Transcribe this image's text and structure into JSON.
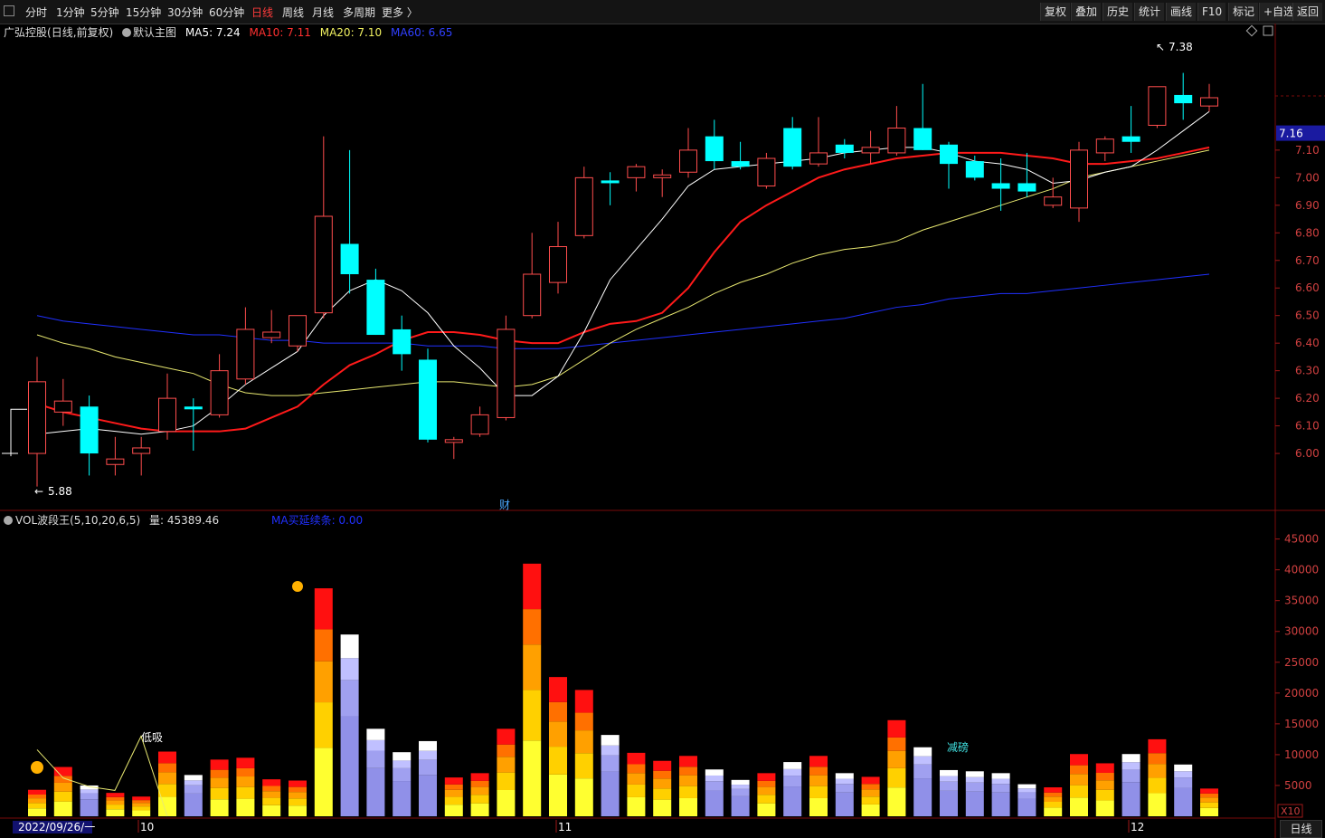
{
  "toolbar": {
    "periods": [
      "分时",
      "1分钟",
      "5分钟",
      "15分钟",
      "30分钟",
      "60分钟",
      "日线",
      "周线",
      "月线",
      "多周期",
      "更多 〉"
    ],
    "active_period": "日线",
    "right_buttons": [
      "复权",
      "叠加",
      "历史",
      "统计",
      "画线",
      "F10",
      "标记",
      "+自选",
      "返回"
    ]
  },
  "main_header": {
    "stock": "广弘控股",
    "mode": "(日线,前复权)",
    "template_label": "默认主图",
    "ma5_label": "MA5: 7.24",
    "ma10_label": "MA10: 7.11",
    "ma20_label": "MA20: 7.10",
    "ma60_label": "MA60: 6.65"
  },
  "vol_header": {
    "indicator": "VOL波段王(5,10,20,6,5)",
    "volume_label": "量: 45389.46",
    "ma_label": "MA买延续条: 0.00"
  },
  "annotations": {
    "high_price": "7.38",
    "low_price": "5.88",
    "finance_marker": "财",
    "low_buy": "低吸",
    "reduce": "减磅",
    "current_price": "7.16",
    "vol_scale_unit": "X10"
  },
  "bottom": {
    "start_date": "2022/09/26/一",
    "month_labels": [
      "10",
      "11",
      "12"
    ],
    "period_tab": "日线"
  },
  "colors": {
    "up": "#ff4d4d",
    "down": "#00ffff",
    "ma5": "#ffffff",
    "ma10": "#ff1a1a",
    "ma20": "#e8e870",
    "ma60": "#2030ff"
  },
  "chart_data": {
    "type": "candlestick",
    "price_axis": {
      "min": 5.8,
      "max": 7.5,
      "ticks": [
        "7.10",
        "7.00",
        "6.90",
        "6.80",
        "6.70",
        "6.60",
        "6.50",
        "6.40",
        "6.30",
        "6.20",
        "6.10",
        "6.00"
      ]
    },
    "volume_axis": {
      "min": 0,
      "max": 47000,
      "ticks": [
        "45000",
        "40000",
        "35000",
        "30000",
        "25000",
        "20000",
        "15000",
        "10000",
        "5000"
      ]
    },
    "candles": [
      {
        "o": 6.0,
        "h": 6.35,
        "l": 5.88,
        "c": 6.26,
        "v": 4300
      },
      {
        "o": 6.15,
        "h": 6.27,
        "l": 6.1,
        "c": 6.19,
        "v": 8000
      },
      {
        "o": 6.17,
        "h": 6.21,
        "l": 5.92,
        "c": 6.0,
        "v": 5000
      },
      {
        "o": 5.96,
        "h": 6.06,
        "l": 5.92,
        "c": 5.98,
        "v": 3800
      },
      {
        "o": 6.0,
        "h": 6.06,
        "l": 5.92,
        "c": 6.02,
        "v": 3200
      },
      {
        "o": 6.08,
        "h": 6.29,
        "l": 6.05,
        "c": 6.2,
        "v": 10500
      },
      {
        "o": 6.17,
        "h": 6.2,
        "l": 6.01,
        "c": 6.16,
        "v": 6700
      },
      {
        "o": 6.14,
        "h": 6.36,
        "l": 6.13,
        "c": 6.3,
        "v": 9200
      },
      {
        "o": 6.27,
        "h": 6.53,
        "l": 6.25,
        "c": 6.45,
        "v": 9500
      },
      {
        "o": 6.42,
        "h": 6.52,
        "l": 6.4,
        "c": 6.44,
        "v": 6000
      },
      {
        "o": 6.39,
        "h": 6.5,
        "l": 6.37,
        "c": 6.5,
        "v": 5800
      },
      {
        "o": 6.51,
        "h": 7.15,
        "l": 6.49,
        "c": 6.86,
        "v": 37000
      },
      {
        "o": 6.76,
        "h": 7.1,
        "l": 6.58,
        "c": 6.65,
        "v": 29500
      },
      {
        "o": 6.63,
        "h": 6.67,
        "l": 6.43,
        "c": 6.43,
        "v": 14200
      },
      {
        "o": 6.45,
        "h": 6.5,
        "l": 6.3,
        "c": 6.36,
        "v": 10400
      },
      {
        "o": 6.34,
        "h": 6.38,
        "l": 6.04,
        "c": 6.05,
        "v": 12200
      },
      {
        "o": 6.04,
        "h": 6.06,
        "l": 5.98,
        "c": 6.05,
        "v": 6300
      },
      {
        "o": 6.07,
        "h": 6.17,
        "l": 6.06,
        "c": 6.14,
        "v": 7000
      },
      {
        "o": 6.13,
        "h": 6.5,
        "l": 6.12,
        "c": 6.45,
        "v": 14200
      },
      {
        "o": 6.5,
        "h": 6.8,
        "l": 6.49,
        "c": 6.65,
        "v": 41000
      },
      {
        "o": 6.62,
        "h": 6.84,
        "l": 6.58,
        "c": 6.75,
        "v": 22600
      },
      {
        "o": 6.79,
        "h": 7.04,
        "l": 6.78,
        "c": 7.0,
        "v": 20500
      },
      {
        "o": 6.99,
        "h": 7.02,
        "l": 6.9,
        "c": 6.98,
        "v": 13200
      },
      {
        "o": 7.0,
        "h": 7.05,
        "l": 6.95,
        "c": 7.04,
        "v": 10300
      },
      {
        "o": 7.0,
        "h": 7.03,
        "l": 6.93,
        "c": 7.01,
        "v": 9000
      },
      {
        "o": 7.02,
        "h": 7.18,
        "l": 7.0,
        "c": 7.1,
        "v": 9800
      },
      {
        "o": 7.15,
        "h": 7.21,
        "l": 7.03,
        "c": 7.06,
        "v": 7600
      },
      {
        "o": 7.06,
        "h": 7.13,
        "l": 7.03,
        "c": 7.04,
        "v": 5900
      },
      {
        "o": 6.97,
        "h": 7.09,
        "l": 6.96,
        "c": 7.07,
        "v": 7000
      },
      {
        "o": 7.18,
        "h": 7.22,
        "l": 7.03,
        "c": 7.04,
        "v": 8800
      },
      {
        "o": 7.05,
        "h": 7.22,
        "l": 7.04,
        "c": 7.09,
        "v": 9800
      },
      {
        "o": 7.12,
        "h": 7.14,
        "l": 7.07,
        "c": 7.09,
        "v": 7000
      },
      {
        "o": 7.09,
        "h": 7.17,
        "l": 7.05,
        "c": 7.11,
        "v": 6400
      },
      {
        "o": 7.09,
        "h": 7.26,
        "l": 7.08,
        "c": 7.18,
        "v": 15600
      },
      {
        "o": 7.18,
        "h": 7.34,
        "l": 7.1,
        "c": 7.1,
        "v": 11200
      },
      {
        "o": 7.12,
        "h": 7.13,
        "l": 6.96,
        "c": 7.05,
        "v": 7500
      },
      {
        "o": 7.06,
        "h": 7.08,
        "l": 6.99,
        "c": 7.0,
        "v": 7300
      },
      {
        "o": 6.98,
        "h": 7.07,
        "l": 6.88,
        "c": 6.96,
        "v": 7000
      },
      {
        "o": 6.98,
        "h": 7.09,
        "l": 6.93,
        "c": 6.95,
        "v": 5200
      },
      {
        "o": 6.9,
        "h": 7.0,
        "l": 6.89,
        "c": 6.93,
        "v": 4700
      },
      {
        "o": 6.89,
        "h": 7.13,
        "l": 6.84,
        "c": 7.1,
        "v": 10100
      },
      {
        "o": 7.09,
        "h": 7.15,
        "l": 7.06,
        "c": 7.14,
        "v": 8600
      },
      {
        "o": 7.15,
        "h": 7.26,
        "l": 7.09,
        "c": 7.13,
        "v": 10100
      },
      {
        "o": 7.19,
        "h": 7.33,
        "l": 7.18,
        "c": 7.33,
        "v": 12500
      },
      {
        "o": 7.3,
        "h": 7.38,
        "l": 7.21,
        "c": 7.27,
        "v": 8400
      },
      {
        "o": 7.26,
        "h": 7.34,
        "l": 7.24,
        "c": 7.29,
        "v": 4500
      }
    ],
    "ma5": [
      6.07,
      6.08,
      6.09,
      6.08,
      6.07,
      6.08,
      6.1,
      6.17,
      6.25,
      6.31,
      6.37,
      6.5,
      6.59,
      6.63,
      6.59,
      6.51,
      6.39,
      6.31,
      6.21,
      6.21,
      6.28,
      6.44,
      6.63,
      6.74,
      6.85,
      6.97,
      7.03,
      7.04,
      7.05,
      7.06,
      7.07,
      7.09,
      7.1,
      7.11,
      7.11,
      7.09,
      7.06,
      7.05,
      7.03,
      6.98,
      6.99,
      7.02,
      7.04,
      7.1,
      7.17,
      7.24
    ],
    "ma10": [
      6.18,
      6.15,
      6.13,
      6.11,
      6.09,
      6.08,
      6.08,
      6.08,
      6.09,
      6.13,
      6.17,
      6.25,
      6.32,
      6.36,
      6.41,
      6.44,
      6.44,
      6.43,
      6.41,
      6.4,
      6.4,
      6.44,
      6.47,
      6.48,
      6.51,
      6.6,
      6.73,
      6.84,
      6.9,
      6.95,
      7.0,
      7.03,
      7.05,
      7.07,
      7.08,
      7.09,
      7.09,
      7.09,
      7.08,
      7.07,
      7.05,
      7.05,
      7.06,
      7.07,
      7.09,
      7.11
    ],
    "ma20": [
      6.43,
      6.4,
      6.38,
      6.35,
      6.33,
      6.31,
      6.29,
      6.25,
      6.22,
      6.21,
      6.21,
      6.22,
      6.23,
      6.24,
      6.25,
      6.26,
      6.26,
      6.25,
      6.24,
      6.25,
      6.28,
      6.34,
      6.4,
      6.45,
      6.49,
      6.53,
      6.58,
      6.62,
      6.65,
      6.69,
      6.72,
      6.74,
      6.75,
      6.77,
      6.81,
      6.84,
      6.87,
      6.9,
      6.93,
      6.96,
      7.0,
      7.02,
      7.04,
      7.06,
      7.08,
      7.1
    ],
    "ma60": [
      6.5,
      6.48,
      6.47,
      6.46,
      6.45,
      6.44,
      6.43,
      6.43,
      6.42,
      6.41,
      6.41,
      6.4,
      6.4,
      6.4,
      6.4,
      6.39,
      6.39,
      6.39,
      6.38,
      6.38,
      6.38,
      6.39,
      6.4,
      6.41,
      6.42,
      6.43,
      6.44,
      6.45,
      6.46,
      6.47,
      6.48,
      6.49,
      6.51,
      6.53,
      6.54,
      6.56,
      6.57,
      6.58,
      6.58,
      6.59,
      6.6,
      6.61,
      6.62,
      6.63,
      6.64,
      6.65
    ],
    "wave_line": [
      null,
      10800,
      6200,
      4800,
      4200,
      13000,
      0
    ]
  }
}
